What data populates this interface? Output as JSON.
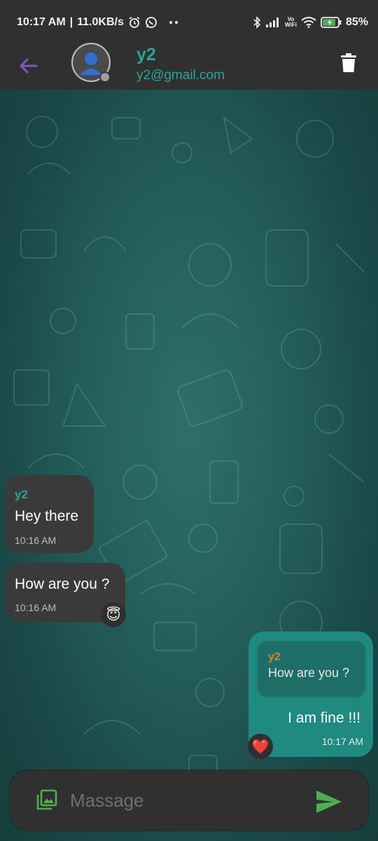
{
  "status_bar": {
    "time": "10:17 AM",
    "network_speed": "11.0KB/s",
    "separator": "|",
    "network_label_top": "Vo",
    "network_label_bottom": "WiFi",
    "battery_percent": "85%",
    "icons": [
      "alarm-icon",
      "whatsapp-icon",
      "more-dots-icon",
      "bluetooth-icon",
      "signal-icon",
      "vowifi-icon",
      "wifi-icon",
      "battery-charging-icon"
    ]
  },
  "header": {
    "contact_name": "y2",
    "contact_email": "y2@gmail.com",
    "online_status_color": "#9e9e9e",
    "icons": [
      "back-arrow-icon",
      "avatar-icon",
      "delete-icon"
    ]
  },
  "messages": [
    {
      "direction": "incoming",
      "sender": "y2",
      "text": "Hey there",
      "time": "10:16 AM",
      "reaction": null
    },
    {
      "direction": "incoming",
      "sender": null,
      "text": "How are you ?",
      "time": "10:16 AM",
      "reaction": "😇"
    },
    {
      "direction": "outgoing",
      "reply_to": {
        "sender": "y2",
        "text": "How are you ?"
      },
      "text": "I am fine !!!",
      "time": "10:17 AM",
      "reaction": "❤️"
    }
  ],
  "composer": {
    "placeholder": "Massage",
    "value": "",
    "icons": [
      "image-attach-icon",
      "send-icon"
    ]
  },
  "colors": {
    "accent": "#26a69a",
    "back_arrow": "#7e57c2",
    "outgoing_bubble": "#1e8a80",
    "incoming_bubble": "#3a3a3a",
    "reply_sender": "#e67e22",
    "send_icon": "#4caf50",
    "bar_background": "#303030"
  }
}
